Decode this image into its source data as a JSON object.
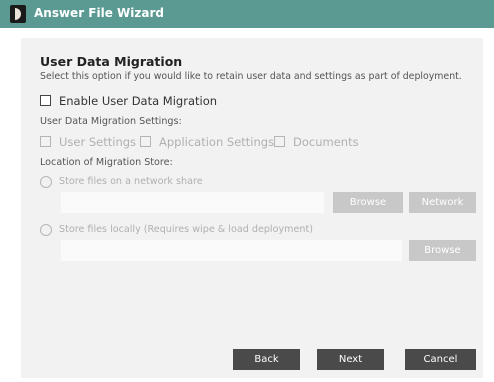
{
  "window": {
    "title": "Answer File Wizard"
  },
  "section": {
    "heading": "User Data Migration",
    "description": "Select this option if you would like to retain user data and settings as part of deployment."
  },
  "enable": {
    "label": "Enable User Data Migration",
    "checked": false
  },
  "settings": {
    "label": "User Data Migration Settings:",
    "options": [
      "User Settings",
      "Application Settings",
      "Documents"
    ]
  },
  "location": {
    "label": "Location of Migration Store:",
    "network_option": "Store files on a network share",
    "local_option": "Store files locally (Requires wipe & load deployment)",
    "browse": "Browse",
    "network": "Network"
  },
  "footer": {
    "back": "Back",
    "next": "Next",
    "cancel": "Cancel"
  },
  "colors": {
    "titlebar": "#5a9a92",
    "panel": "#f2f2f2",
    "button_dark": "#4a4a4a",
    "button_disabled": "#c8c8c8"
  }
}
